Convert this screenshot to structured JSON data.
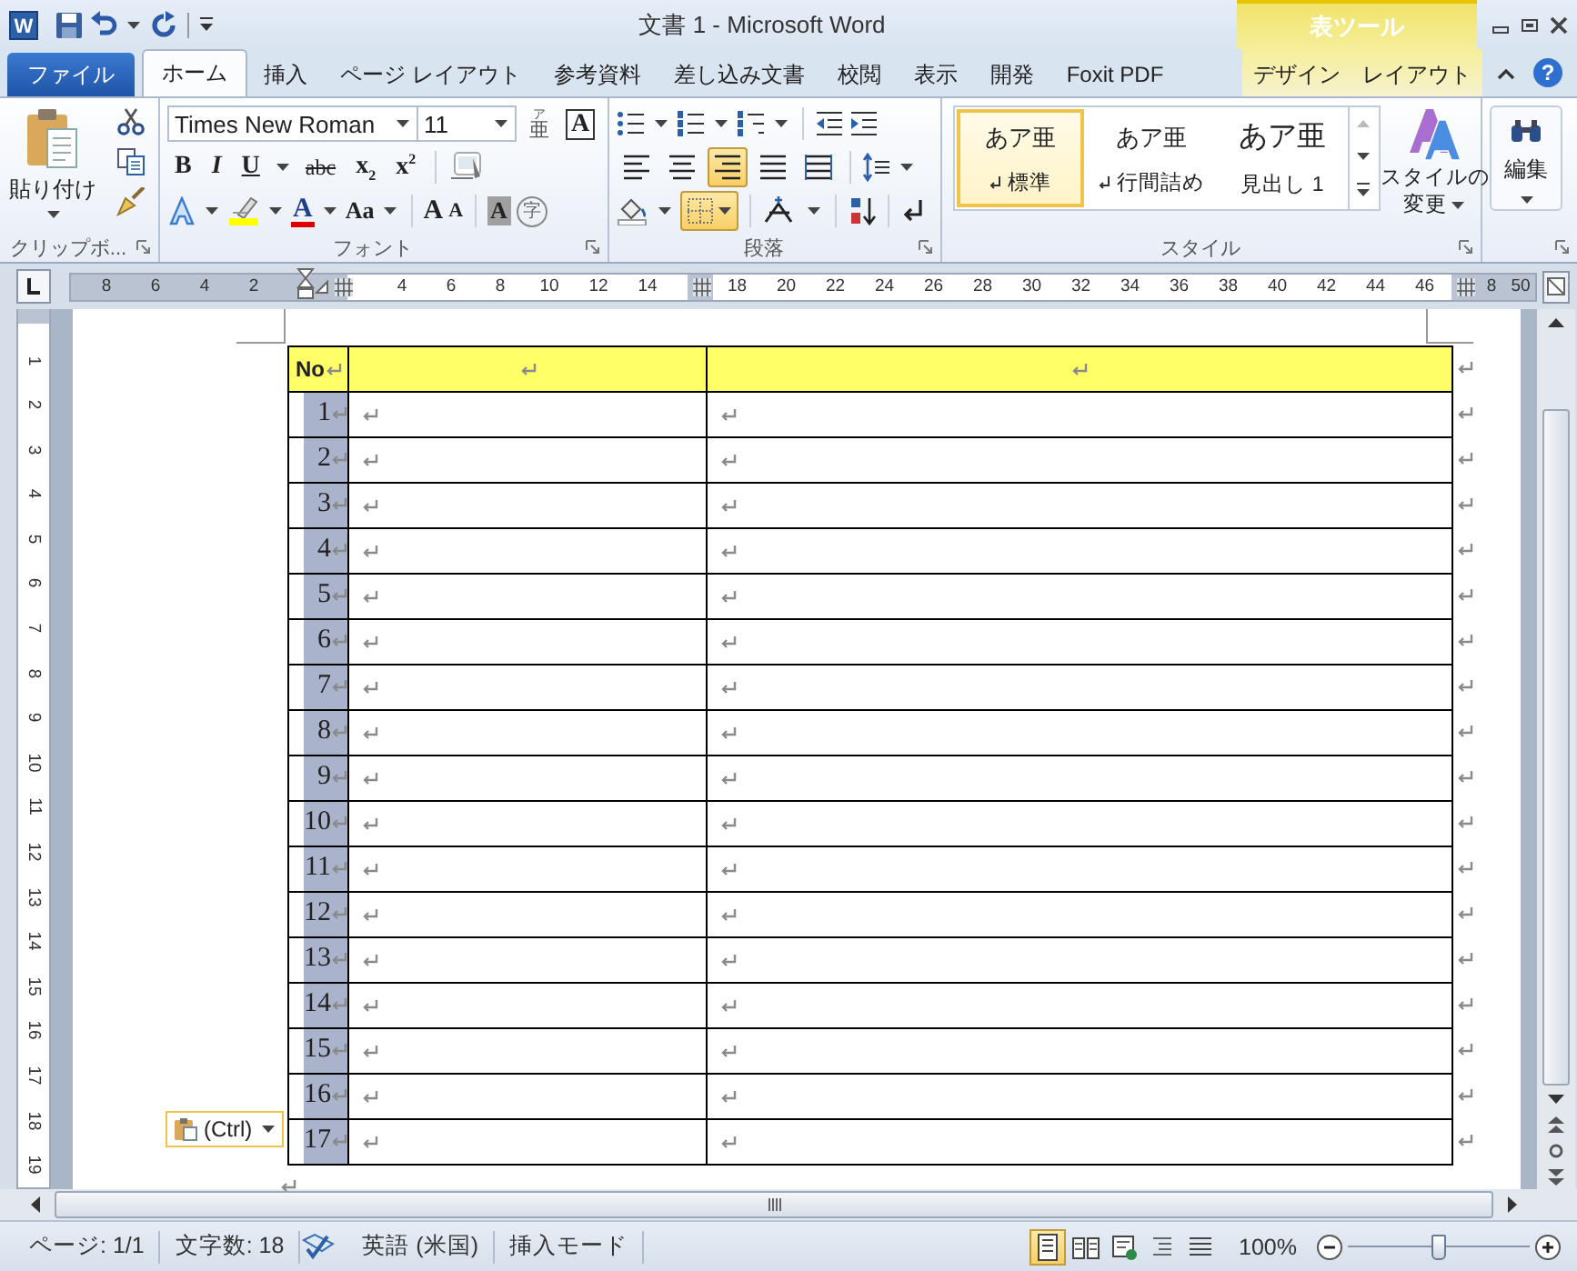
{
  "window": {
    "app_icon": "W",
    "title": "文書 1 - Microsoft Word",
    "context_title": "表ツール"
  },
  "tabs": [
    {
      "label": "ファイル",
      "kind": "file",
      "selected": false
    },
    {
      "label": "ホーム",
      "kind": "normal",
      "selected": true
    },
    {
      "label": "挿入",
      "kind": "normal",
      "selected": false
    },
    {
      "label": "ページ レイアウト",
      "kind": "normal",
      "selected": false
    },
    {
      "label": "参考資料",
      "kind": "normal",
      "selected": false
    },
    {
      "label": "差し込み文書",
      "kind": "normal",
      "selected": false
    },
    {
      "label": "校閲",
      "kind": "normal",
      "selected": false
    },
    {
      "label": "表示",
      "kind": "normal",
      "selected": false
    },
    {
      "label": "開発",
      "kind": "normal",
      "selected": false
    },
    {
      "label": "Foxit PDF",
      "kind": "normal",
      "selected": false
    },
    {
      "label": "デザイン",
      "kind": "context",
      "selected": false
    },
    {
      "label": "レイアウト",
      "kind": "context",
      "selected": false
    }
  ],
  "help": "?",
  "ribbon": {
    "clipboard": {
      "paste": "貼り付け",
      "label": "クリップボ..."
    },
    "font": {
      "name": "Times New Roman",
      "size": "11",
      "ruby_top": "ア",
      "ruby_base": "亜",
      "border_char": "A",
      "format": [
        {
          "kind": "bold",
          "text": "B"
        },
        {
          "kind": "italic",
          "text": "I"
        },
        {
          "kind": "underline",
          "text": "U"
        },
        {
          "kind": "strike",
          "text": "abc"
        },
        {
          "kind": "sub",
          "text": "x$_{2}$"
        },
        {
          "kind": "sup",
          "text": "x$^{2}$"
        }
      ],
      "font_color": "A",
      "case": "Aa",
      "grow": "A",
      "shrink": "A",
      "shading_char": "A",
      "enclose": "字",
      "label": "フォント"
    },
    "paragraph": {
      "align": [
        {
          "kind": "left",
          "selected": false
        },
        {
          "kind": "center",
          "selected": false
        },
        {
          "kind": "right",
          "selected": true
        },
        {
          "kind": "justify",
          "selected": false
        },
        {
          "kind": "distributed",
          "selected": false
        }
      ],
      "borders_on": true,
      "label": "段落"
    },
    "styles": {
      "items": [
        {
          "preview": "あア亜",
          "name": "標準",
          "linked": true,
          "selected": true
        },
        {
          "preview": "あア亜",
          "name": "行間詰め",
          "linked": true,
          "selected": false
        },
        {
          "preview": "あア亜",
          "name": "見出し 1",
          "linked": false,
          "selected": false
        }
      ],
      "change": "スタイルの",
      "change2": "変更",
      "label": "スタイル"
    },
    "editing": {
      "label": "編集"
    }
  },
  "ruler": {
    "segments": [
      {
        "kind": "margin",
        "labels": [
          "8",
          "6",
          "4",
          "2"
        ]
      },
      {
        "kind": "cell",
        "labels": [
          "4",
          "6",
          "8",
          "10",
          "12",
          "14"
        ]
      },
      {
        "kind": "cell",
        "labels": [
          "18",
          "20",
          "22",
          "24",
          "26",
          "28",
          "30",
          "32",
          "34",
          "36",
          "38",
          "40",
          "42",
          "44",
          "46"
        ]
      },
      {
        "kind": "margin",
        "labels": [
          "8",
          "50"
        ]
      }
    ]
  },
  "vruler": [
    "1",
    "2",
    "3",
    "4",
    "5",
    "6",
    "7",
    "8",
    "9",
    "10",
    "11",
    "12",
    "13",
    "14",
    "15",
    "16",
    "17",
    "18",
    "19"
  ],
  "table": {
    "columns": [
      {
        "kind": "number",
        "title": "No"
      },
      {
        "kind": "text"
      },
      {
        "kind": "text"
      }
    ],
    "rows": [
      {
        "no": "1",
        "selected": true
      },
      {
        "no": "2",
        "selected": true
      },
      {
        "no": "3",
        "selected": true
      },
      {
        "no": "4",
        "selected": true
      },
      {
        "no": "5",
        "selected": true
      },
      {
        "no": "6",
        "selected": true
      },
      {
        "no": "7",
        "selected": true
      },
      {
        "no": "8",
        "selected": true
      },
      {
        "no": "9",
        "selected": true
      },
      {
        "no": "10",
        "selected": true
      },
      {
        "no": "11",
        "selected": true
      },
      {
        "no": "12",
        "selected": true
      },
      {
        "no": "13",
        "selected": true
      },
      {
        "no": "14",
        "selected": true
      },
      {
        "no": "15",
        "selected": true
      },
      {
        "no": "16",
        "selected": true
      },
      {
        "no": "17",
        "selected": true
      }
    ]
  },
  "paste_options": "(Ctrl)",
  "status": {
    "page": "ページ: 1/1",
    "words": "文字数: 18",
    "language": "英語 (米国)",
    "mode": "挿入モード",
    "views": [
      {
        "kind": "print",
        "selected": true
      },
      {
        "kind": "reading",
        "selected": false
      },
      {
        "kind": "web",
        "selected": false
      },
      {
        "kind": "outline",
        "selected": false
      },
      {
        "kind": "draft",
        "selected": false
      }
    ],
    "zoom": "100%",
    "zoom_slider": {
      "level": 0.5
    }
  }
}
